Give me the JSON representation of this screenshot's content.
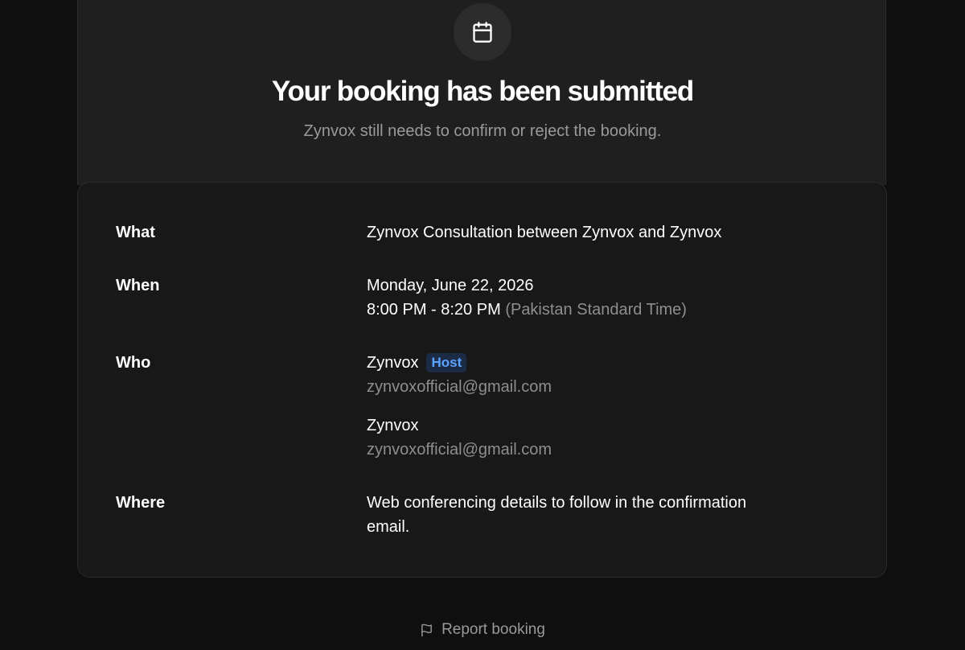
{
  "header": {
    "icon": "calendar-icon",
    "title": "Your booking has been submitted",
    "subtitle": "Zynvox still needs to confirm or reject the booking."
  },
  "details": {
    "what": {
      "label": "What",
      "value": "Zynvox Consultation between Zynvox and Zynvox"
    },
    "when": {
      "label": "When",
      "date": "Monday, June 22, 2026",
      "time": "8:00 PM - 8:20 PM",
      "timezone": "(Pakistan Standard Time)"
    },
    "who": {
      "label": "Who",
      "attendees": [
        {
          "name": "Zynvox",
          "badge": "Host",
          "email": "zynvoxofficial@gmail.com"
        },
        {
          "name": "Zynvox",
          "email": "zynvoxofficial@gmail.com"
        }
      ]
    },
    "where": {
      "label": "Where",
      "line1": "Web conferencing details to follow in the confirmation",
      "line2": "email."
    }
  },
  "footer": {
    "report_icon": "flag-icon",
    "report_label": "Report booking"
  },
  "colors": {
    "background": "#0f0f0f",
    "panel": "#1f1f1f",
    "card": "#181818",
    "host_badge_text": "#5aa2ff",
    "host_badge_bg": "#1c2b45"
  }
}
